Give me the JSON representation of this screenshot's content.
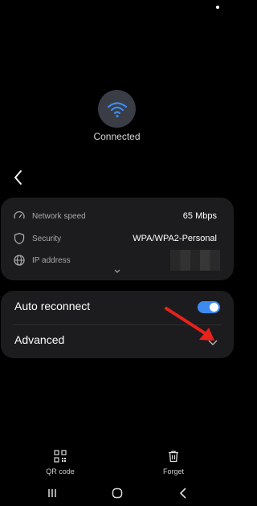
{
  "header": {
    "status": "Connected"
  },
  "network_info": {
    "rows": [
      {
        "label": "Network speed",
        "value": "65 Mbps",
        "icon": "speedometer-icon"
      },
      {
        "label": "Security",
        "value": "WPA/WPA2-Personal",
        "icon": "shield-icon"
      },
      {
        "label": "IP address",
        "value": "",
        "icon": "globe-icon"
      }
    ]
  },
  "settings": {
    "auto_reconnect": {
      "label": "Auto reconnect",
      "enabled": true
    },
    "advanced": {
      "label": "Advanced"
    }
  },
  "bottom_actions": {
    "qr": {
      "label": "QR code",
      "icon": "qr-code-icon"
    },
    "forget": {
      "label": "Forget",
      "icon": "trash-icon"
    }
  },
  "colors": {
    "accent": "#3e8bf0",
    "card_bg": "#1c1c1e",
    "annotation_arrow": "#e8211c"
  }
}
